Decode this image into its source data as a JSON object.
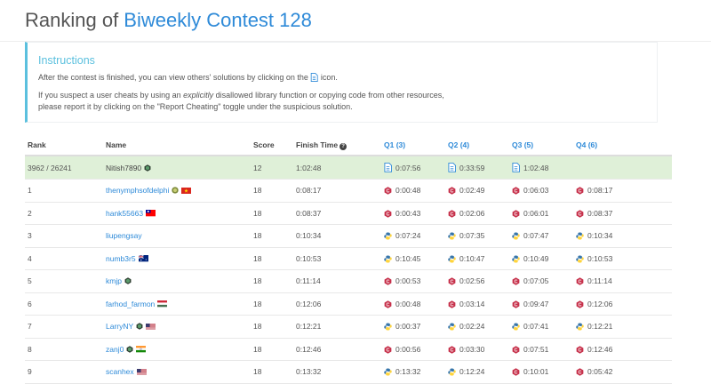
{
  "header": {
    "title_prefix": "Ranking of ",
    "contest_name": "Biweekly Contest 128"
  },
  "instructions": {
    "title": "Instructions",
    "line1_before": "After the contest is finished, you can view others' solutions by clicking on the ",
    "line1_after": " icon.",
    "line2_a": "If you suspect a user cheats by using an ",
    "line2_em": "explicitly",
    "line2_b": " disallowed library function or copying code from other resources,",
    "line3": "please report it by clicking on the \"Report Cheating\" toggle under the suspicious solution."
  },
  "table": {
    "headers": {
      "rank": "Rank",
      "name": "Name",
      "score": "Score",
      "finish": "Finish Time",
      "q1": "Q1 (3)",
      "q2": "Q2 (4)",
      "q3": "Q3 (5)",
      "q4": "Q4 (6)"
    },
    "rows": [
      {
        "rank": "3962 / 26241",
        "name": "Nitish7890",
        "score": "12",
        "finish": "1:02:48",
        "q1": "0:07:56",
        "q2": "0:33:59",
        "q3": "1:02:48",
        "q4": ""
      },
      {
        "rank": "1",
        "name": "thenymphsofdelphi",
        "score": "18",
        "finish": "0:08:17",
        "q1": "0:00:48",
        "q2": "0:02:49",
        "q3": "0:06:03",
        "q4": "0:08:17"
      },
      {
        "rank": "2",
        "name": "hank55663",
        "score": "18",
        "finish": "0:08:37",
        "q1": "0:00:43",
        "q2": "0:02:06",
        "q3": "0:06:01",
        "q4": "0:08:37"
      },
      {
        "rank": "3",
        "name": "liupengsay",
        "score": "18",
        "finish": "0:10:34",
        "q1": "0:07:24",
        "q2": "0:07:35",
        "q3": "0:07:47",
        "q4": "0:10:34"
      },
      {
        "rank": "4",
        "name": "numb3r5",
        "score": "18",
        "finish": "0:10:53",
        "q1": "0:10:45",
        "q2": "0:10:47",
        "q3": "0:10:49",
        "q4": "0:10:53"
      },
      {
        "rank": "5",
        "name": "kmjp",
        "score": "18",
        "finish": "0:11:14",
        "q1": "0:00:53",
        "q2": "0:02:56",
        "q3": "0:07:05",
        "q4": "0:11:14"
      },
      {
        "rank": "6",
        "name": "farhod_farmon",
        "score": "18",
        "finish": "0:12:06",
        "q1": "0:00:48",
        "q2": "0:03:14",
        "q3": "0:09:47",
        "q4": "0:12:06"
      },
      {
        "rank": "7",
        "name": "LarryNY",
        "score": "18",
        "finish": "0:12:21",
        "q1": "0:00:37",
        "q2": "0:02:24",
        "q3": "0:07:41",
        "q4": "0:12:21"
      },
      {
        "rank": "8",
        "name": "zanj0",
        "score": "18",
        "finish": "0:12:46",
        "q1": "0:00:56",
        "q2": "0:03:30",
        "q3": "0:07:51",
        "q4": "0:12:46"
      },
      {
        "rank": "9",
        "name": "scanhex",
        "score": "18",
        "finish": "0:13:32",
        "q1": "0:13:32",
        "q2": "0:12:24",
        "q3": "0:10:01",
        "q4": "0:05:42"
      }
    ]
  },
  "colors": {
    "accent": "#2e8ad8",
    "info": "#5bc0de",
    "highlight": "#dff0d8",
    "cpp": "#c6304a",
    "python_blue": "#3776ab",
    "python_yellow": "#ffd43b"
  }
}
